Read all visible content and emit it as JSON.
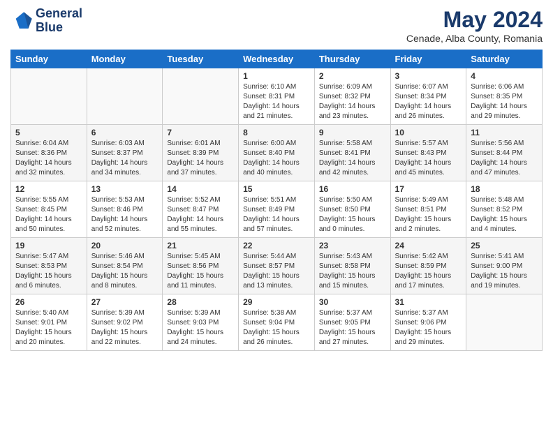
{
  "header": {
    "logo_line1": "General",
    "logo_line2": "Blue",
    "main_title": "May 2024",
    "subtitle": "Cenade, Alba County, Romania"
  },
  "days_of_week": [
    "Sunday",
    "Monday",
    "Tuesday",
    "Wednesday",
    "Thursday",
    "Friday",
    "Saturday"
  ],
  "weeks": [
    [
      {
        "day": "",
        "info": ""
      },
      {
        "day": "",
        "info": ""
      },
      {
        "day": "",
        "info": ""
      },
      {
        "day": "1",
        "info": "Sunrise: 6:10 AM\nSunset: 8:31 PM\nDaylight: 14 hours\nand 21 minutes."
      },
      {
        "day": "2",
        "info": "Sunrise: 6:09 AM\nSunset: 8:32 PM\nDaylight: 14 hours\nand 23 minutes."
      },
      {
        "day": "3",
        "info": "Sunrise: 6:07 AM\nSunset: 8:34 PM\nDaylight: 14 hours\nand 26 minutes."
      },
      {
        "day": "4",
        "info": "Sunrise: 6:06 AM\nSunset: 8:35 PM\nDaylight: 14 hours\nand 29 minutes."
      }
    ],
    [
      {
        "day": "5",
        "info": "Sunrise: 6:04 AM\nSunset: 8:36 PM\nDaylight: 14 hours\nand 32 minutes."
      },
      {
        "day": "6",
        "info": "Sunrise: 6:03 AM\nSunset: 8:37 PM\nDaylight: 14 hours\nand 34 minutes."
      },
      {
        "day": "7",
        "info": "Sunrise: 6:01 AM\nSunset: 8:39 PM\nDaylight: 14 hours\nand 37 minutes."
      },
      {
        "day": "8",
        "info": "Sunrise: 6:00 AM\nSunset: 8:40 PM\nDaylight: 14 hours\nand 40 minutes."
      },
      {
        "day": "9",
        "info": "Sunrise: 5:58 AM\nSunset: 8:41 PM\nDaylight: 14 hours\nand 42 minutes."
      },
      {
        "day": "10",
        "info": "Sunrise: 5:57 AM\nSunset: 8:43 PM\nDaylight: 14 hours\nand 45 minutes."
      },
      {
        "day": "11",
        "info": "Sunrise: 5:56 AM\nSunset: 8:44 PM\nDaylight: 14 hours\nand 47 minutes."
      }
    ],
    [
      {
        "day": "12",
        "info": "Sunrise: 5:55 AM\nSunset: 8:45 PM\nDaylight: 14 hours\nand 50 minutes."
      },
      {
        "day": "13",
        "info": "Sunrise: 5:53 AM\nSunset: 8:46 PM\nDaylight: 14 hours\nand 52 minutes."
      },
      {
        "day": "14",
        "info": "Sunrise: 5:52 AM\nSunset: 8:47 PM\nDaylight: 14 hours\nand 55 minutes."
      },
      {
        "day": "15",
        "info": "Sunrise: 5:51 AM\nSunset: 8:49 PM\nDaylight: 14 hours\nand 57 minutes."
      },
      {
        "day": "16",
        "info": "Sunrise: 5:50 AM\nSunset: 8:50 PM\nDaylight: 15 hours\nand 0 minutes."
      },
      {
        "day": "17",
        "info": "Sunrise: 5:49 AM\nSunset: 8:51 PM\nDaylight: 15 hours\nand 2 minutes."
      },
      {
        "day": "18",
        "info": "Sunrise: 5:48 AM\nSunset: 8:52 PM\nDaylight: 15 hours\nand 4 minutes."
      }
    ],
    [
      {
        "day": "19",
        "info": "Sunrise: 5:47 AM\nSunset: 8:53 PM\nDaylight: 15 hours\nand 6 minutes."
      },
      {
        "day": "20",
        "info": "Sunrise: 5:46 AM\nSunset: 8:54 PM\nDaylight: 15 hours\nand 8 minutes."
      },
      {
        "day": "21",
        "info": "Sunrise: 5:45 AM\nSunset: 8:56 PM\nDaylight: 15 hours\nand 11 minutes."
      },
      {
        "day": "22",
        "info": "Sunrise: 5:44 AM\nSunset: 8:57 PM\nDaylight: 15 hours\nand 13 minutes."
      },
      {
        "day": "23",
        "info": "Sunrise: 5:43 AM\nSunset: 8:58 PM\nDaylight: 15 hours\nand 15 minutes."
      },
      {
        "day": "24",
        "info": "Sunrise: 5:42 AM\nSunset: 8:59 PM\nDaylight: 15 hours\nand 17 minutes."
      },
      {
        "day": "25",
        "info": "Sunrise: 5:41 AM\nSunset: 9:00 PM\nDaylight: 15 hours\nand 19 minutes."
      }
    ],
    [
      {
        "day": "26",
        "info": "Sunrise: 5:40 AM\nSunset: 9:01 PM\nDaylight: 15 hours\nand 20 minutes."
      },
      {
        "day": "27",
        "info": "Sunrise: 5:39 AM\nSunset: 9:02 PM\nDaylight: 15 hours\nand 22 minutes."
      },
      {
        "day": "28",
        "info": "Sunrise: 5:39 AM\nSunset: 9:03 PM\nDaylight: 15 hours\nand 24 minutes."
      },
      {
        "day": "29",
        "info": "Sunrise: 5:38 AM\nSunset: 9:04 PM\nDaylight: 15 hours\nand 26 minutes."
      },
      {
        "day": "30",
        "info": "Sunrise: 5:37 AM\nSunset: 9:05 PM\nDaylight: 15 hours\nand 27 minutes."
      },
      {
        "day": "31",
        "info": "Sunrise: 5:37 AM\nSunset: 9:06 PM\nDaylight: 15 hours\nand 29 minutes."
      },
      {
        "day": "",
        "info": ""
      }
    ]
  ]
}
